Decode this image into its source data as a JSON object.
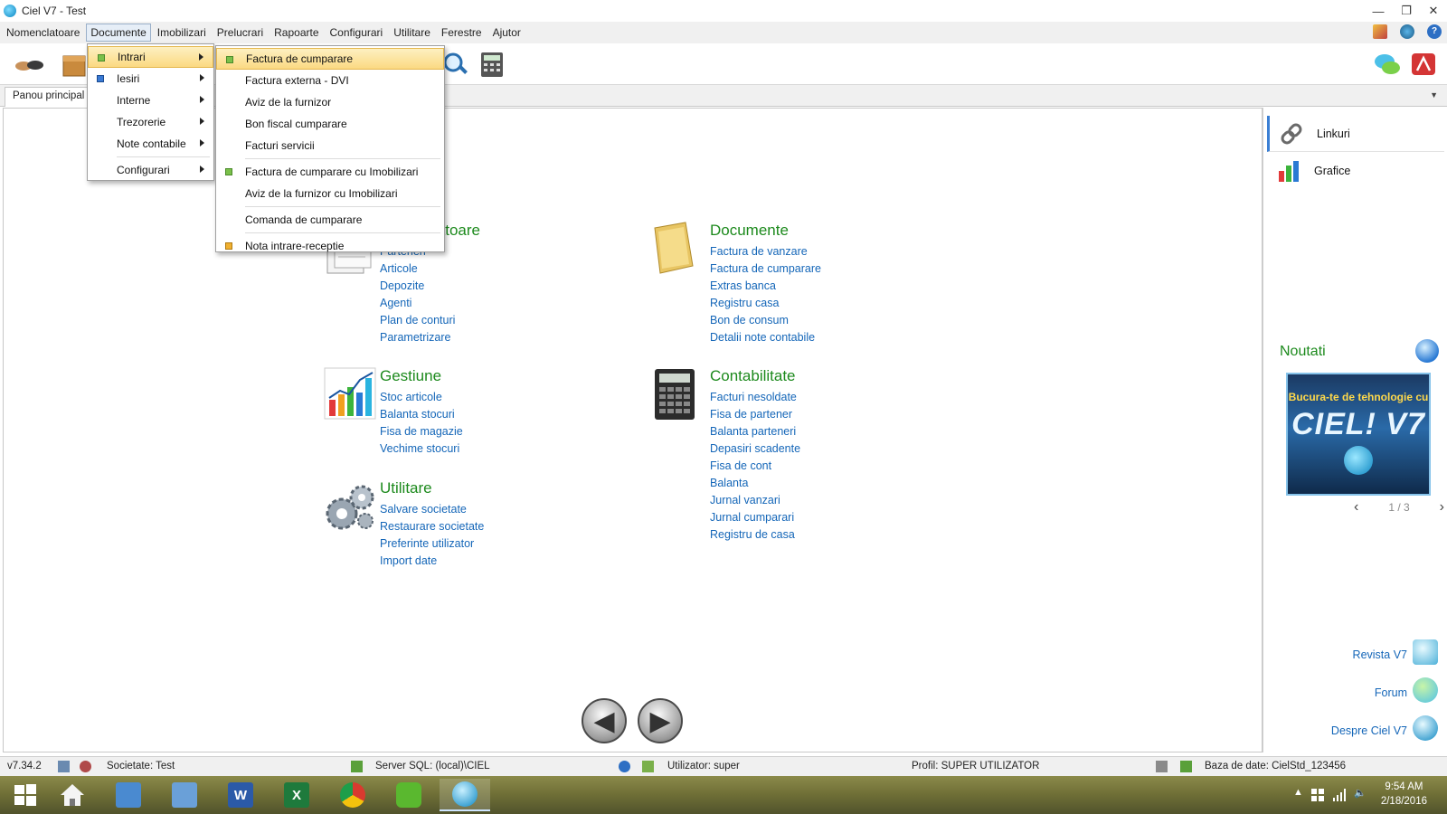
{
  "window": {
    "title": "Ciel V7 - Test",
    "minimize": "▭",
    "restore": "❐",
    "close": "✕"
  },
  "menubar": {
    "items": [
      "Nomenclatoare",
      "Documente",
      "Imobilizari",
      "Prelucrari",
      "Rapoarte",
      "Configurari",
      "Utilitare",
      "Ferestre",
      "Ajutor"
    ],
    "active_index": 1,
    "help_label": "?"
  },
  "tabs": {
    "main_tab": "Panou principal"
  },
  "documente_menu": {
    "items": [
      {
        "label": "Intrari",
        "icon": "green-doc-icon",
        "has_submenu": true,
        "highlighted": true
      },
      {
        "label": "Iesiri",
        "icon": "blue-doc-icon",
        "has_submenu": true
      },
      {
        "label": "Interne",
        "has_submenu": true
      },
      {
        "label": "Trezorerie",
        "has_submenu": true
      },
      {
        "label": "Note contabile",
        "has_submenu": true
      },
      {
        "label": "Configurari",
        "has_submenu": true
      }
    ]
  },
  "intrari_submenu": {
    "items": [
      {
        "label": "Factura de cumparare",
        "icon": "green-doc-icon",
        "highlighted": true
      },
      {
        "label": "Factura externa - DVI"
      },
      {
        "label": "Aviz de la furnizor"
      },
      {
        "label": "Bon fiscal cumparare"
      },
      {
        "label": "Facturi servicii"
      },
      {
        "label": "Factura de cumparare cu Imobilizari",
        "icon": "green-doc-icon"
      },
      {
        "label": "Aviz de la furnizor cu Imobilizari"
      },
      {
        "label": "Comanda de cumparare"
      },
      {
        "label": "Nota intrare-receptie",
        "icon": "orange-doc-icon"
      }
    ]
  },
  "dashboard": {
    "nomenclatoare": {
      "title_partial": "latoare",
      "links": [
        "Parteneri",
        "Articole",
        "Depozite",
        "Agenti",
        "Plan de conturi",
        "Parametrizare"
      ]
    },
    "documente": {
      "title": "Documente",
      "links": [
        "Factura de vanzare",
        "Factura de cumparare",
        "Extras banca",
        "Registru casa",
        "Bon de consum",
        "Detalii note contabile"
      ]
    },
    "gestiune": {
      "title": "Gestiune",
      "links": [
        "Stoc articole",
        "Balanta stocuri",
        "Fisa de magazie",
        "Vechime stocuri"
      ]
    },
    "contabilitate": {
      "title": "Contabilitate",
      "links": [
        "Facturi nesoldate",
        "Fisa de partener",
        "Balanta parteneri",
        "Depasiri scadente",
        "Fisa de cont",
        "Balanta",
        "Jurnal vanzari",
        "Jurnal cumparari",
        "Registru de casa"
      ]
    },
    "utilitare": {
      "title": "Utilitare",
      "links": [
        "Salvare societate",
        "Restaurare societate",
        "Preferinte utilizator",
        "Import date"
      ]
    },
    "nav": {
      "back": "◀",
      "forward": "▶"
    }
  },
  "right_panel": {
    "items": [
      {
        "label": "Linkuri",
        "icon": "chain-link-icon"
      },
      {
        "label": "Grafice",
        "icon": "bar-chart-icon"
      }
    ],
    "noutati_title": "Noutati",
    "banner": {
      "line1": "Bucura-te de tehnologie cu",
      "logo": "CIEL! V7"
    },
    "pager": {
      "text": "1 / 3",
      "prev": "‹",
      "next": "›"
    },
    "links": [
      "Revista V7",
      "Forum",
      "Despre Ciel V7"
    ]
  },
  "statusbar": {
    "version": "v7.34.2",
    "societate": "Societate: Test",
    "server": "Server SQL: (local)\\CIEL",
    "utilizator": "Utilizator: super",
    "profil": "Profil: SUPER UTILIZATOR",
    "baza": "Baza de date: CielStd_123456"
  },
  "taskbar": {
    "apps": [
      "start",
      "home",
      "control-panel",
      "computer",
      "word",
      "excel",
      "chrome",
      "wechat",
      "ciel"
    ],
    "word_label": "W",
    "excel_label": "X",
    "time": "9:54 AM",
    "date": "2/18/2016"
  },
  "colors": {
    "green_title": "#1d8a1d",
    "link_blue": "#1466b8",
    "highlight": "#fbd982"
  }
}
